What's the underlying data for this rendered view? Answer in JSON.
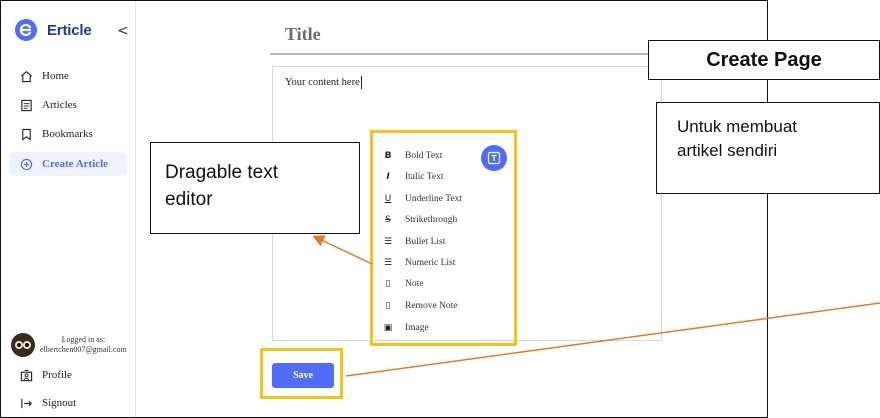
{
  "brand": {
    "name": "Erticle"
  },
  "sidebar": {
    "collapse_glyph": "<",
    "items": [
      {
        "label": "Home",
        "icon": "home-icon"
      },
      {
        "label": "Articles",
        "icon": "articles-icon"
      },
      {
        "label": "Bookmarks",
        "icon": "bookmark-icon"
      },
      {
        "label": "Create Article",
        "icon": "plus-circle-icon",
        "active": true
      }
    ],
    "user": {
      "logged_in_label": "Logged in as:",
      "email": "elbertchen007@gmail.com"
    },
    "bottom_items": [
      {
        "label": "Profile",
        "icon": "profile-icon"
      },
      {
        "label": "Signout",
        "icon": "signout-icon"
      }
    ]
  },
  "editor": {
    "title_placeholder": "Title",
    "content_placeholder": "Your content here",
    "toolbar": [
      {
        "label": "Bold Text",
        "glyph": "B",
        "icon": "bold-icon"
      },
      {
        "label": "Italic Text",
        "glyph": "I",
        "icon": "italic-icon"
      },
      {
        "label": "Underline Text",
        "glyph": "U",
        "icon": "underline-icon"
      },
      {
        "label": "Strikethrough",
        "glyph": "S",
        "icon": "strikethrough-icon"
      },
      {
        "label": "Bullet List",
        "glyph": "☰",
        "icon": "bullet-list-icon"
      },
      {
        "label": "Numeric List",
        "glyph": "☰",
        "icon": "numeric-list-icon"
      },
      {
        "label": "Note",
        "glyph": "▯",
        "icon": "note-icon"
      },
      {
        "label": "Remove Note",
        "glyph": "▯",
        "icon": "remove-note-icon"
      },
      {
        "label": "Image",
        "glyph": "▣",
        "icon": "image-icon"
      }
    ],
    "save_label": "Save"
  },
  "annotations": {
    "create_page": "Create Page",
    "create_desc_line1": "Untuk membuat",
    "create_desc_line2": "artikel sendiri",
    "drag_line1": "Dragable text",
    "drag_line2": "editor"
  },
  "colors": {
    "accent": "#4f6df5",
    "brand_text": "#1f3a8a",
    "highlight": "#f2c31b",
    "arrow": "#e07b2a"
  }
}
